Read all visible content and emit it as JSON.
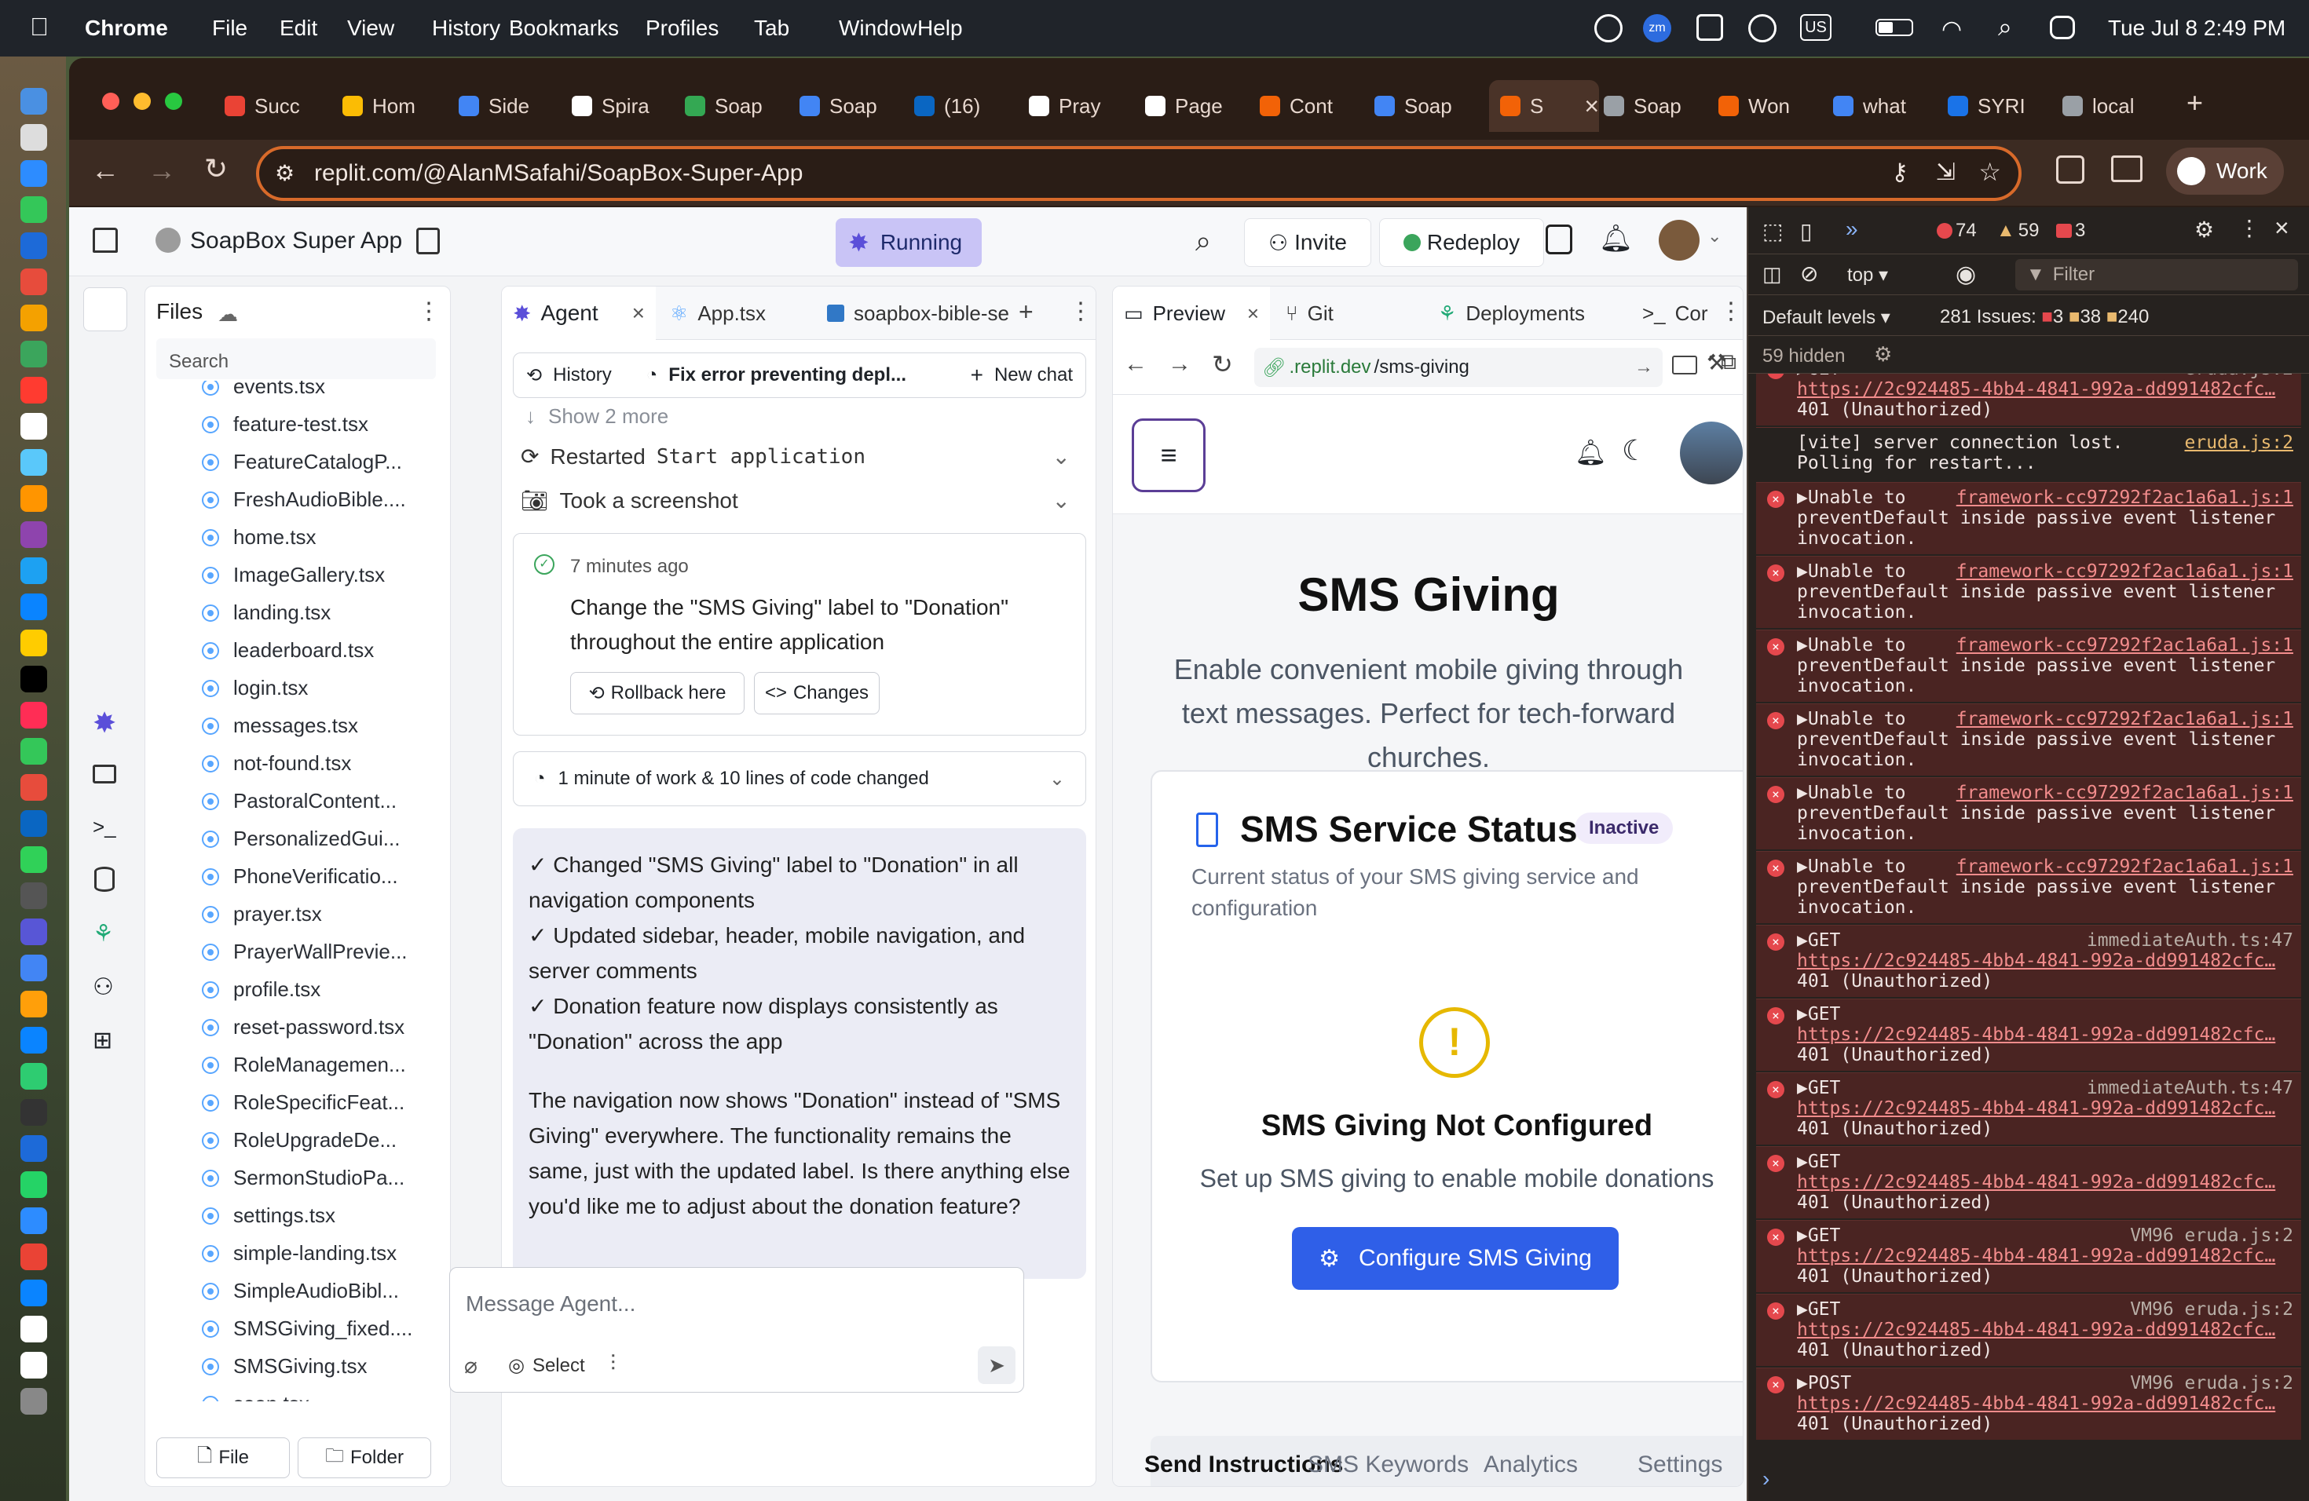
{
  "menubar": {
    "apple": "",
    "app": "Chrome",
    "items": [
      "File",
      "Edit",
      "View",
      "History",
      "Bookmarks",
      "Profiles",
      "Tab",
      "Window",
      "Help"
    ],
    "layout_badge": "US",
    "datetime": "Tue Jul 8  2:49 PM",
    "zm": "zm"
  },
  "tabs": [
    {
      "label": "Succ",
      "color": "#ea4335"
    },
    {
      "label": "Hom",
      "color": "#fbbc04"
    },
    {
      "label": "Side",
      "color": "#4285f4"
    },
    {
      "label": "Spira",
      "color": "#ffffff"
    },
    {
      "label": "Soap",
      "color": "#34a853"
    },
    {
      "label": "Soap",
      "color": "#4285f4"
    },
    {
      "label": "(16)",
      "color": "#0a66c2"
    },
    {
      "label": "Pray",
      "color": "#ffffff"
    },
    {
      "label": "Page",
      "color": "#ffffff"
    },
    {
      "label": "Cont",
      "color": "#f26207"
    },
    {
      "label": "Soap",
      "color": "#4285f4"
    },
    {
      "label": "S",
      "color": "#f26207",
      "active": true
    },
    {
      "label": "Soap",
      "color": "#9aa0a6"
    },
    {
      "label": "Won",
      "color": "#f26207"
    },
    {
      "label": "what",
      "color": "#4285f4"
    },
    {
      "label": "SYRI",
      "color": "#1a73e8"
    },
    {
      "label": "local",
      "color": "#9aa0a6"
    }
  ],
  "omnibox": {
    "url": "replit.com/@AlanMSafahi/SoapBox-Super-App"
  },
  "profile": {
    "label": "Work"
  },
  "workspace": {
    "title": "SoapBox Super App",
    "status": "Running",
    "invite": "Invite",
    "redeploy": "Redeploy"
  },
  "files": {
    "title": "Files",
    "search_placeholder": "Search",
    "items": [
      "events.tsx",
      "feature-test.tsx",
      "FeatureCatalogP...",
      "FreshAudioBible....",
      "home.tsx",
      "ImageGallery.tsx",
      "landing.tsx",
      "leaderboard.tsx",
      "login.tsx",
      "messages.tsx",
      "not-found.tsx",
      "PastoralContent...",
      "PersonalizedGui...",
      "PhoneVerificatio...",
      "prayer.tsx",
      "PrayerWallPrevie...",
      "profile.tsx",
      "reset-password.tsx",
      "RoleManagemen...",
      "RoleSpecificFeat...",
      "RoleUpgradeDe...",
      "SermonStudioPa...",
      "settings.tsx",
      "simple-landing.tsx",
      "SimpleAudioBibl...",
      "SMSGiving_fixed....",
      "SMSGiving.tsx",
      "soap.tsx"
    ],
    "file_button": "File",
    "folder_button": "Folder"
  },
  "agent": {
    "tabs": [
      "Agent",
      "App.tsx",
      "soapbox-bible-se"
    ],
    "history": "History",
    "chat_title": "Fix error preventing depl...",
    "new_chat": "New chat",
    "show_more": "Show 2 more",
    "restarted_prefix": "Restarted",
    "restarted_cmd": "Start application",
    "screenshot": "Took a screenshot",
    "checkpoint_time": "7 minutes ago",
    "checkpoint_text": "Change the \"SMS Giving\" label to \"Donation\" throughout the entire application",
    "rollback": "Rollback here",
    "changes": "Changes",
    "work_summary": "1 minute of work & 10 lines of code changed",
    "msg_lines": [
      "✓ Changed \"SMS Giving\" label to \"Donation\" in all navigation components",
      "✓ Updated sidebar, header, mobile navigation, and server comments",
      "✓ Donation feature now displays consistently as \"Donation\" across the app"
    ],
    "msg_para": "The navigation now shows \"Donation\" instead of \"SMS Giving\" everywhere. The functionality remains the same, just with the updated label. Is there anything else you'd like me to adjust about the donation feature?",
    "input_placeholder": "Message Agent...",
    "select": "Select"
  },
  "preview": {
    "tabs": [
      "Preview",
      "Git",
      "Deployments",
      "Cor"
    ],
    "url_prefix": ".replit.dev",
    "url_path": "/sms-giving",
    "title": "SMS Giving",
    "subtitle": "Enable convenient mobile giving through text messages. Perfect for tech-forward churches.",
    "card_title": "SMS Service Status",
    "badge": "Inactive",
    "card_desc": "Current status of your SMS giving service and configuration",
    "warn_title": "SMS Giving Not Configured",
    "warn_desc": "Set up SMS giving to enable mobile donations",
    "configure": "Configure SMS Giving",
    "bottom_tabs": [
      "Send Instructions",
      "SMS Keywords",
      "Analytics",
      "Settings"
    ]
  },
  "devtools": {
    "errors": "74",
    "warnings": "59",
    "issues_badge": "3",
    "context": "top",
    "filter": "Filter",
    "levels": "Default levels",
    "issues_label": "281 Issues:",
    "issue_err": "3",
    "issue_warn": "38",
    "issue_info": "240",
    "hidden": "59 hidden",
    "log": [
      {
        "kind": "err",
        "head": "▶GET",
        "src": "eruda.js:2",
        "url": "https://2c924485-4bb4-4841-992a-dd991482cfc…",
        "tail": "401 (Unauthorized)"
      },
      {
        "kind": "info",
        "head": "[vite] server connection lost.",
        "src": "eruda.js:2",
        "tail": "Polling for restart..."
      },
      {
        "kind": "err",
        "head": "▶Unable to",
        "src": "framework-cc97292f2ac1a6a1.js:1",
        "tail": "preventDefault inside passive event listener invocation."
      },
      {
        "kind": "err",
        "head": "▶Unable to",
        "src": "framework-cc97292f2ac1a6a1.js:1",
        "tail": "preventDefault inside passive event listener invocation."
      },
      {
        "kind": "err",
        "head": "▶Unable to",
        "src": "framework-cc97292f2ac1a6a1.js:1",
        "tail": "preventDefault inside passive event listener invocation."
      },
      {
        "kind": "err",
        "head": "▶Unable to",
        "src": "framework-cc97292f2ac1a6a1.js:1",
        "tail": "preventDefault inside passive event listener invocation."
      },
      {
        "kind": "err",
        "head": "▶Unable to",
        "src": "framework-cc97292f2ac1a6a1.js:1",
        "tail": "preventDefault inside passive event listener invocation."
      },
      {
        "kind": "err",
        "head": "▶Unable to",
        "src": "framework-cc97292f2ac1a6a1.js:1",
        "tail": "preventDefault inside passive event listener invocation."
      },
      {
        "kind": "err",
        "head": "▶GET",
        "src": "immediateAuth.ts:47",
        "url": "https://2c924485-4bb4-4841-992a-dd991482cfc…",
        "tail": "401 (Unauthorized)"
      },
      {
        "kind": "err",
        "head": "▶GET",
        "src": "",
        "url": "https://2c924485-4bb4-4841-992a-dd991482cfc…",
        "tail": "401 (Unauthorized)"
      },
      {
        "kind": "err",
        "head": "▶GET",
        "src": "immediateAuth.ts:47",
        "url": "https://2c924485-4bb4-4841-992a-dd991482cfc…",
        "tail": "401 (Unauthorized)"
      },
      {
        "kind": "err",
        "head": "▶GET",
        "src": "",
        "url": "https://2c924485-4bb4-4841-992a-dd991482cfc…",
        "tail": "401 (Unauthorized)"
      },
      {
        "kind": "err",
        "head": "▶GET",
        "src": "VM96 eruda.js:2",
        "url": "https://2c924485-4bb4-4841-992a-dd991482cfc…",
        "tail": "401 (Unauthorized)"
      },
      {
        "kind": "err",
        "head": "▶GET",
        "src": "VM96 eruda.js:2",
        "url": "https://2c924485-4bb4-4841-992a-dd991482cfc…",
        "tail": "401 (Unauthorized)"
      },
      {
        "kind": "err",
        "head": "▶POST",
        "src": "VM96 eruda.js:2",
        "url": "https://2c924485-4bb4-4841-992a-dd991482cfc…",
        "tail": "401 (Unauthorized)"
      }
    ],
    "prompt": "›"
  },
  "colors": {
    "accent": "#3b5bdb",
    "replit_orange": "#f26207",
    "running": "#c3bff5",
    "warning": "#e6b800",
    "error": "#e5484d"
  }
}
